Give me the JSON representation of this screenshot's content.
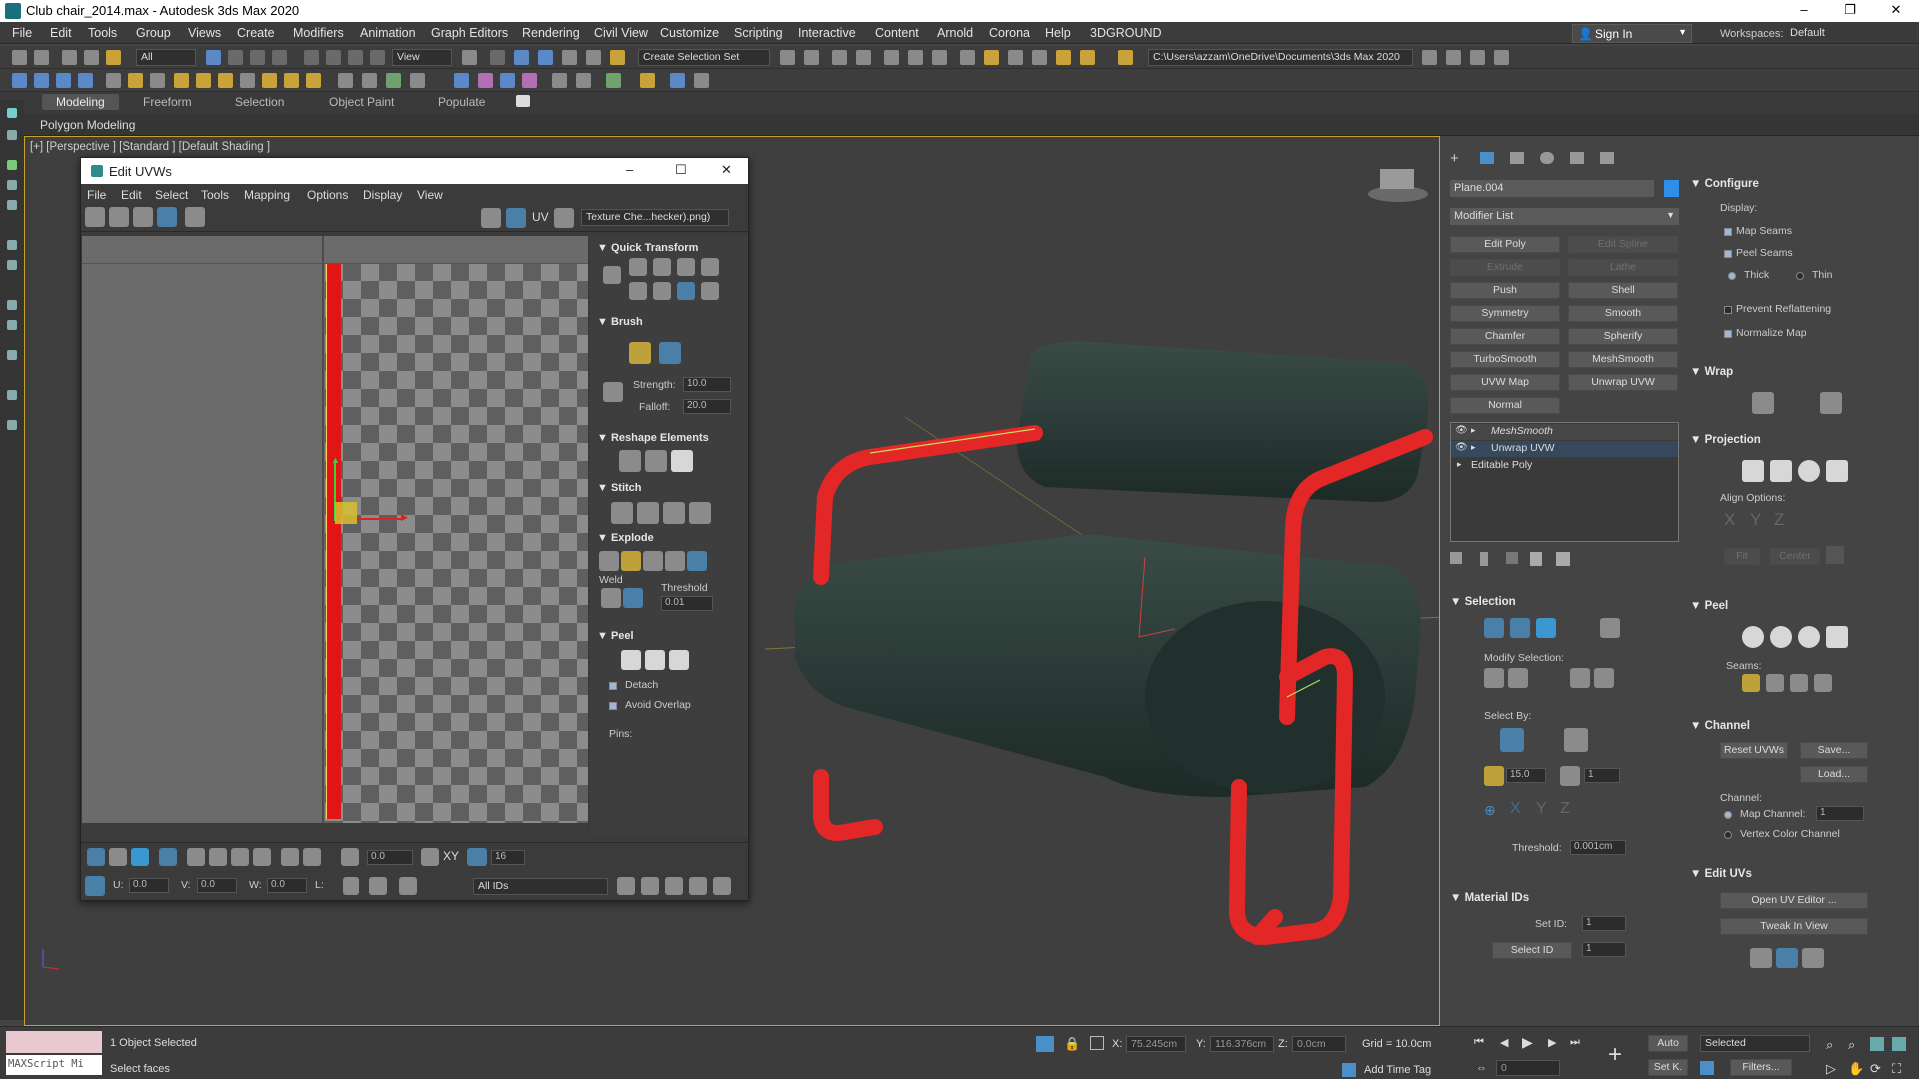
{
  "window": {
    "title": "Club chair_2014.max - Autodesk 3ds Max 2020",
    "minimize": "–",
    "maximize": "❐",
    "close": "✕"
  },
  "menubar": {
    "items": [
      "File",
      "Edit",
      "Tools",
      "Group",
      "Views",
      "Create",
      "Modifiers",
      "Animation",
      "Graph Editors",
      "Rendering",
      "Civil View",
      "Customize",
      "Scripting",
      "Interactive",
      "Content",
      "Arnold",
      "Corona",
      "Help",
      "3DGROUND"
    ],
    "sign_in": "Sign In",
    "workspaces_label": "Workspaces:",
    "workspace": "Default"
  },
  "toolbar": {
    "filter": "All",
    "view": "View",
    "selection_set": "Create Selection Set",
    "path": "C:\\Users\\azzam\\OneDrive\\Documents\\3ds Max 2020"
  },
  "ribbon": {
    "tabs": [
      "Modeling",
      "Freeform",
      "Selection",
      "Object Paint",
      "Populate"
    ],
    "active": "Modeling",
    "panel": "Polygon Modeling"
  },
  "viewport": {
    "label": "[+] [Perspective ] [Standard ] [Default Shading ]"
  },
  "uvw": {
    "title": "Edit UVWs",
    "menu": [
      "File",
      "Edit",
      "Select",
      "Tools",
      "Mapping",
      "Options",
      "Display",
      "View"
    ],
    "uv_label": "UV",
    "texture": "Texture Che...hecker).png)",
    "quick_transform": "Quick Transform",
    "brush": "Brush",
    "strength_label": "Strength:",
    "strength": "10.0",
    "falloff_label": "Falloff:",
    "falloff": "20.0",
    "reshape": "Reshape Elements",
    "stitch": "Stitch",
    "explode": "Explode",
    "weld": "Weld",
    "threshold_label": "Threshold",
    "threshold": "0.01",
    "peel": "Peel",
    "detach": "Detach",
    "avoid_overlap": "Avoid Overlap",
    "pins": "Pins:",
    "angle": "0.0",
    "grid_count": "16",
    "u_label": "U:",
    "u": "0.0",
    "v_label": "V:",
    "v": "0.0",
    "w_label": "W:",
    "w": "0.0",
    "l_label": "L:",
    "ids": "All IDs",
    "xy": "XY"
  },
  "modify": {
    "object_name": "Plane.004",
    "object_color": "#2e8ee8",
    "modifier_list": "Modifier List",
    "buttons": [
      [
        "Edit Poly",
        "Edit Spline"
      ],
      [
        "Extrude",
        "Lathe"
      ],
      [
        "Push",
        "Shell"
      ],
      [
        "Symmetry",
        "Smooth"
      ],
      [
        "Chamfer",
        "Spherify"
      ],
      [
        "TurboSmooth",
        "MeshSmooth"
      ],
      [
        "UVW Map",
        "Unwrap UVW"
      ],
      [
        "Normal",
        ""
      ]
    ],
    "disabled": [
      "Edit Spline",
      "Extrude",
      "Lathe"
    ],
    "stack": [
      "MeshSmooth",
      "Unwrap UVW",
      "Editable Poly"
    ],
    "selection": "Selection",
    "modify_selection": "Modify Selection:",
    "select_by": "Select By:",
    "angle": "15.0",
    "poly_count": "1",
    "threshold_label": "Threshold:",
    "threshold": "0.001cm",
    "material_ids": "Material IDs",
    "set_id_label": "Set ID:",
    "set_id": "1",
    "select_id": "Select ID",
    "select_id_val": "1"
  },
  "configure": {
    "title": "Configure",
    "display": "Display:",
    "map_seams": "Map Seams",
    "peel_seams": "Peel Seams",
    "thick": "Thick",
    "thin": "Thin",
    "prevent": "Prevent Reflattening",
    "normalize": "Normalize Map",
    "wrap": "Wrap",
    "projection": "Projection",
    "align": "Align Options:",
    "axes": [
      "X",
      "Y",
      "Z"
    ],
    "fit": "Fit",
    "center": "Center",
    "peel": "Peel",
    "seams": "Seams:",
    "channel": "Channel",
    "reset": "Reset UVWs",
    "save": "Save...",
    "load": "Load...",
    "channel_label": "Channel:",
    "map_channel": "Map Channel:",
    "map_channel_val": "1",
    "vertex_color": "Vertex Color Channel",
    "edit_uvs": "Edit UVs",
    "open_editor": "Open UV Editor ...",
    "tweak": "Tweak In View"
  },
  "status": {
    "objects": "1 Object Selected",
    "prompt": "Select faces",
    "maxscript": "MAXScript Mi",
    "x_label": "X:",
    "x": "75.245cm",
    "y_label": "Y:",
    "y": "116.376cm",
    "z_label": "Z:",
    "z": "0.0cm",
    "grid": "Grid = 10.0cm",
    "auto": "Auto",
    "selected": "Selected",
    "set_k": "Set K.",
    "filters": "Filters...",
    "frame": "0",
    "add_time_tag": "Add Time Tag"
  }
}
